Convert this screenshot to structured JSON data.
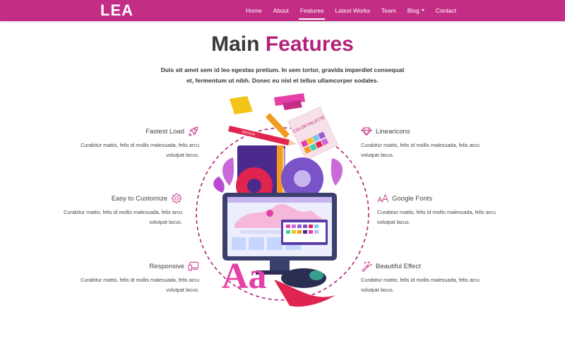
{
  "navbar": {
    "brand": "LEA",
    "items": [
      {
        "label": "Home"
      },
      {
        "label": "About"
      },
      {
        "label": "Features",
        "active": true
      },
      {
        "label": "Latest Works"
      },
      {
        "label": "Team"
      },
      {
        "label": "Blog",
        "dropdown": true
      },
      {
        "label": "Contact"
      }
    ]
  },
  "section": {
    "title_main": "Main",
    "title_accent": "Features",
    "lead": "Duis sit amet sem id leo egestas pretium. In sem tortor, gravida imperdiet consequat et, fermentum ut nibh. Donec eu nisl et tellus ullamcorper sodales."
  },
  "features": {
    "left": [
      {
        "title": "Fastest Load",
        "icon": "rocket-icon",
        "desc": "Curabitur mattis, felis id mollis malesuada, felis arcu volutpat lacus."
      },
      {
        "title": "Easy to Customize",
        "icon": "gear-icon",
        "desc": "Curabitur mattis, felis id mollis malesuada, felis arcu volutpat lacus."
      },
      {
        "title": "Responsive",
        "icon": "devices-icon",
        "desc": "Curabitur mattis, felis id mollis malesuada, felis arcu volutpat lacus."
      }
    ],
    "right": [
      {
        "title": "Linearicons",
        "icon": "diamond-icon",
        "desc": "Curabitur mattis, felis id mollis malesuada, felis arcu volutpat lacus."
      },
      {
        "title": "Google Fonts",
        "icon": "font-size-icon",
        "desc": "Curabitur mattis, felis id mollis malesuada, felis arcu volutpat lacus."
      },
      {
        "title": "Beautiful Effect",
        "icon": "magic-wand-icon",
        "desc": "Curabitur mattis, felis id mollis malesuada, felis arcu volutpat lacus."
      }
    ]
  },
  "illustration": {
    "palette_label": "COLOR PALETTE",
    "design_label": "DESIGN",
    "letters": "Aa"
  },
  "colors": {
    "primary": "#c42d86",
    "accent": "#b3217a",
    "heading": "#3a3a3a"
  }
}
